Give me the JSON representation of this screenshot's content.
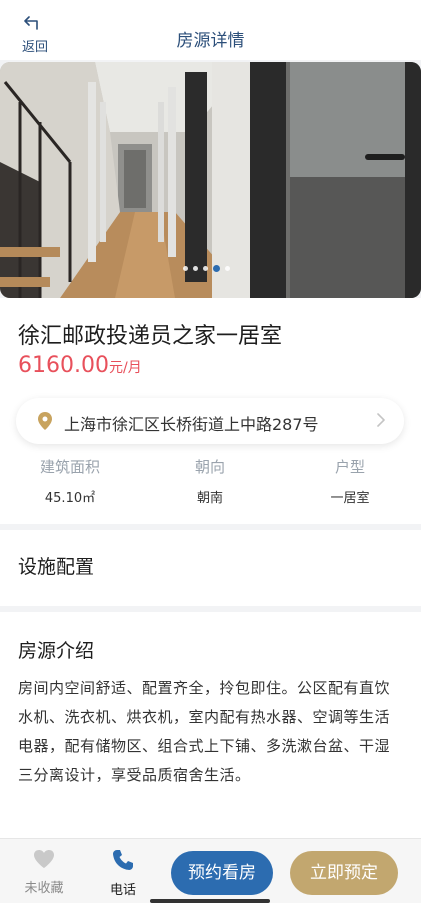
{
  "header": {
    "back_label": "返回",
    "title": "房源详情"
  },
  "gallery": {
    "total_images": 5,
    "current_index": 4
  },
  "listing": {
    "title": "徐汇邮政投递员之家一居室",
    "price_value": "6160.00",
    "price_unit": "元/月",
    "address": "上海市徐汇区长桥街道上中路287号",
    "specs": [
      {
        "label": "建筑面积",
        "value": "45.10㎡"
      },
      {
        "label": "朝向",
        "value": "朝南"
      },
      {
        "label": "户型",
        "value": "一居室"
      }
    ]
  },
  "facilities": {
    "title": "设施配置"
  },
  "intro": {
    "title": "房源介绍",
    "text": "房间内空间舒适、配置齐全，拎包即住。公区配有直饮水机、洗衣机、烘衣机，室内配有热水器、空调等生活电器，配有储物区、组合式上下铺、多洗漱台盆、干湿三分离设计，享受品质宿舍生活。"
  },
  "bottom_bar": {
    "favorite_label": "未收藏",
    "phone_label": "电话",
    "view_button": "预约看房",
    "book_button": "立即预定"
  },
  "colors": {
    "brand_blue": "#2c6cb0",
    "gold": "#c2a76f",
    "price_red": "#e8505b",
    "title_blue": "#2c4f7a"
  }
}
